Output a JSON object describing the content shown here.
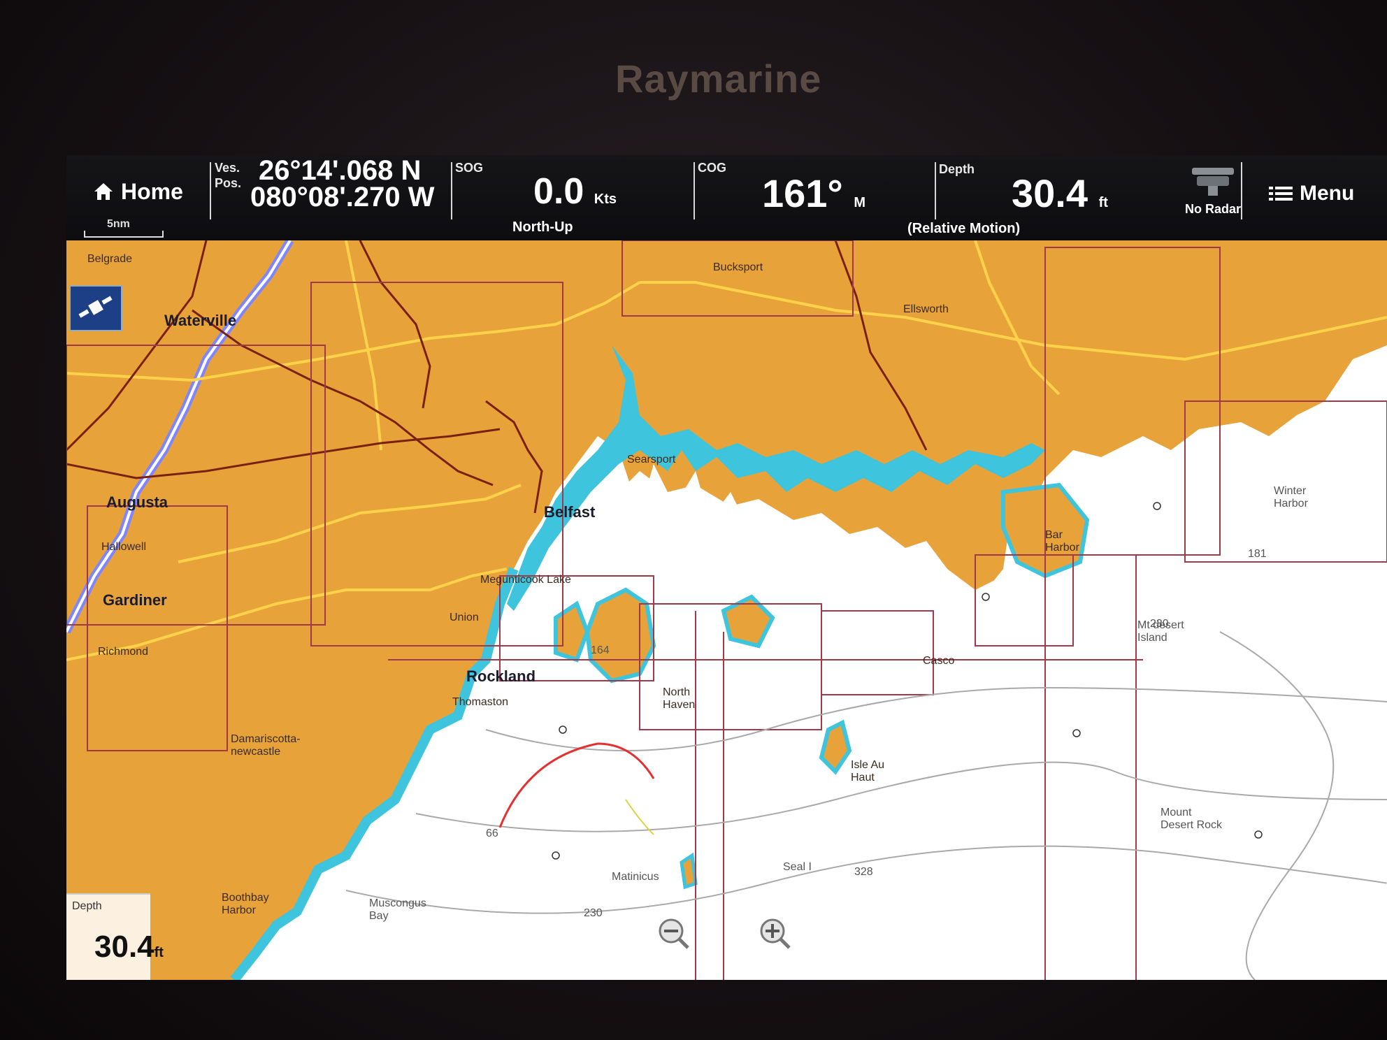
{
  "brand": "Raymarine",
  "topbar": {
    "home_label": "Home",
    "vessel_position": {
      "label_line1": "Ves.",
      "label_line2": "Pos.",
      "lat": "26°14'.068 N",
      "lon": "080°08'.270 W"
    },
    "sog": {
      "label": "SOG",
      "value": "0.0",
      "unit": "Kts"
    },
    "cog": {
      "label": "COG",
      "value": "161°",
      "unit": "M"
    },
    "depth": {
      "label": "Depth",
      "value": "30.4",
      "unit": "ft"
    },
    "radar_status": "No Radar",
    "menu_label": "Menu",
    "orientation": "North-Up",
    "motion_mode": "(Relative Motion)",
    "scale": "5nm"
  },
  "map": {
    "places": [
      {
        "name": "Waterville",
        "class": "big-town"
      },
      {
        "name": "Augusta",
        "class": "big-town"
      },
      {
        "name": "Hallowell",
        "class": ""
      },
      {
        "name": "Gardiner",
        "class": "big-town"
      },
      {
        "name": "Richmond",
        "class": ""
      },
      {
        "name": "Damariscotta-\nnewcastle",
        "class": ""
      },
      {
        "name": "Boothbay\nHarbor",
        "class": ""
      },
      {
        "name": "Searsport",
        "class": ""
      },
      {
        "name": "Belfast",
        "class": "big-town"
      },
      {
        "name": "Bucksport",
        "class": ""
      },
      {
        "name": "Ellsworth",
        "class": ""
      },
      {
        "name": "Megunticook Lake",
        "class": ""
      },
      {
        "name": "Union",
        "class": ""
      },
      {
        "name": "Rockland",
        "class": "big-town"
      },
      {
        "name": "Thomaston",
        "class": ""
      },
      {
        "name": "North\nHaven",
        "class": ""
      },
      {
        "name": "Bar\nHarbor",
        "class": ""
      },
      {
        "name": "Mt desert\nIsland",
        "class": "water"
      },
      {
        "name": "Casco",
        "class": ""
      },
      {
        "name": "Isle Au\nHaut",
        "class": ""
      },
      {
        "name": "Matinicus",
        "class": "water"
      },
      {
        "name": "Seal I",
        "class": "water"
      },
      {
        "name": "Muscongus\nBay",
        "class": "water"
      },
      {
        "name": "Mount\nDesert Rock",
        "class": "water"
      },
      {
        "name": "Belgrade",
        "class": ""
      },
      {
        "name": "Winter\nHarbor",
        "class": "water"
      }
    ],
    "soundings": [
      "164",
      "230",
      "328",
      "181",
      "230",
      "66"
    ]
  },
  "depth_overlay": {
    "label": "Depth",
    "value": "30.4",
    "unit": "ft"
  },
  "colors": {
    "land": "#e8a23a",
    "shallow": "#3ec4dc",
    "deep": "#ffffff",
    "road_major": "#ffd24a",
    "road_minor": "#7a2010",
    "chart_boundary": "#a03a4a",
    "river": "#7e86ff"
  }
}
